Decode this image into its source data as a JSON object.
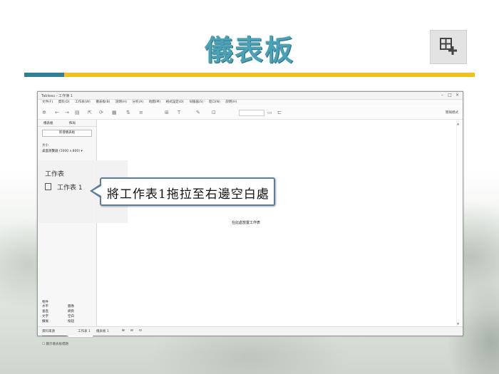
{
  "slide": {
    "title": "儀表板",
    "accent_colors": {
      "teal": "#2f7f96",
      "gold": "#f2c21c",
      "title": "#4aa0b4"
    },
    "icon": "new-dashboard-icon"
  },
  "window": {
    "title": "Tableau - 工作簿 1",
    "menu": [
      "文件(F)",
      "資料(D)",
      "工作表(W)",
      "儀表板(B)",
      "說明(H)",
      "分析(A)",
      "地圖(M)",
      "格式設定(O)",
      "伺服器(S)",
      "窗口(N)",
      "說明(H)"
    ],
    "present_label": "簡報模式",
    "left_tabs": [
      "儀表板",
      "佈局"
    ],
    "new_dashboard_button": "新增儀表板",
    "size_label": "大小",
    "size_value": "桌面瀏覽器 (1000 x 800)",
    "sheets_title": "工作表",
    "sheet_item": "工作表 1",
    "objects_title": "物件",
    "objects": [
      "水平",
      "圖像",
      "垂直",
      "網頁",
      "文字",
      "空白",
      "擴展",
      "按鈕"
    ],
    "tiled_label": "平鋪",
    "floating_label": "浮動",
    "show_title_label": "顯示儀表板標題",
    "canvas_drop_text": "在此處放置工作表",
    "status": {
      "datasource": "資料來源",
      "sheet1_tab": "工作表 1",
      "dashboard1_tab": "儀表板 1"
    }
  },
  "callout": {
    "text": "將工作表1拖拉至右邊空白處"
  }
}
